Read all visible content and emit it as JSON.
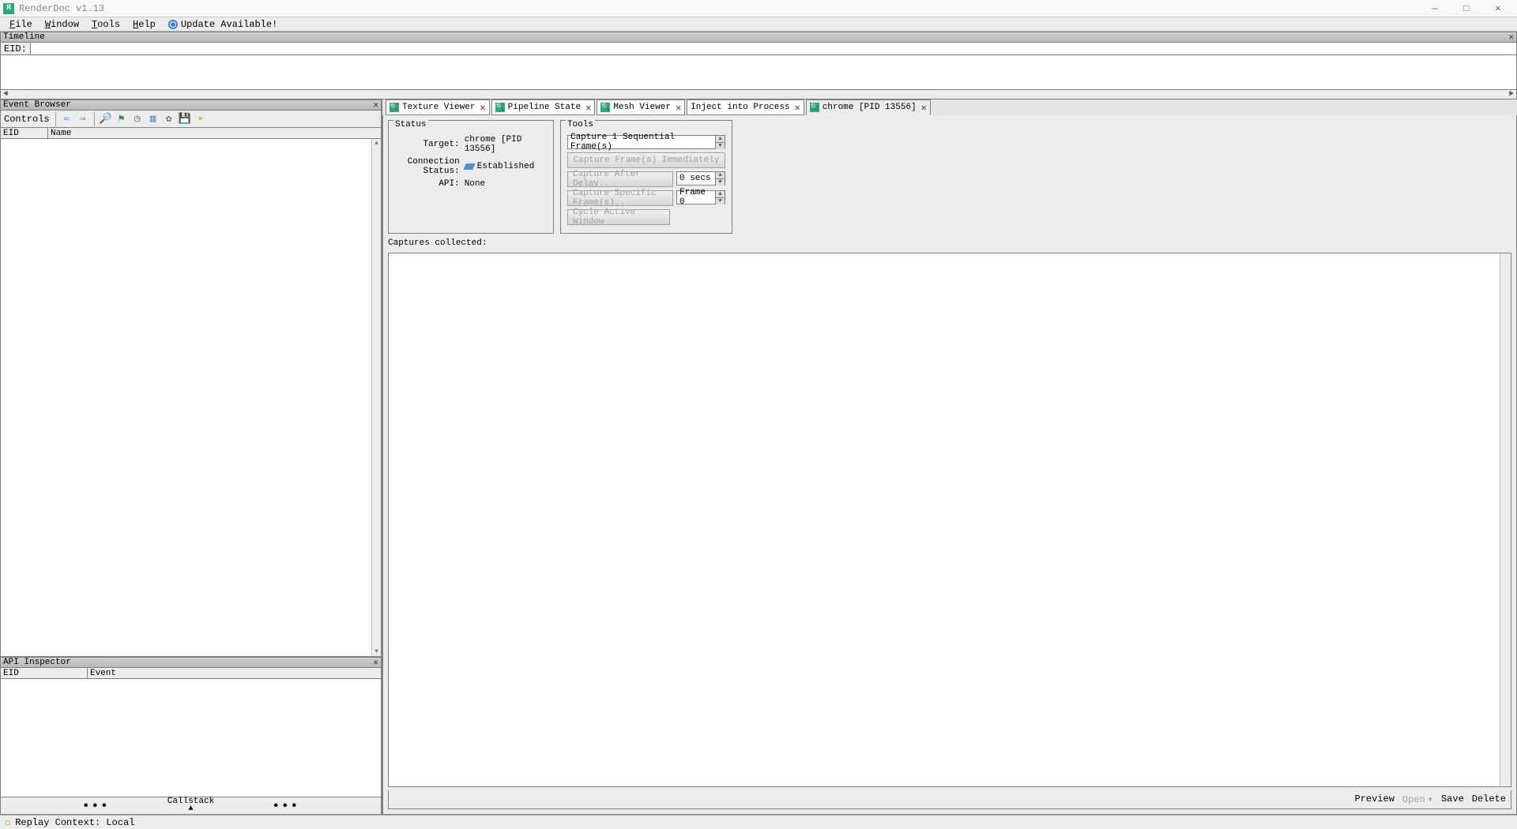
{
  "app": {
    "title": "RenderDoc v1.13"
  },
  "window_controls": {
    "min": "—",
    "max": "□",
    "close": "✕"
  },
  "menu": {
    "file": "File",
    "window": "Window",
    "tools": "Tools",
    "help": "Help",
    "update": "Update Available!"
  },
  "timeline": {
    "title": "Timeline",
    "eid_label": "EID:",
    "eid_value": ""
  },
  "event_browser": {
    "title": "Event Browser",
    "controls_label": "Controls",
    "col_eid": "EID",
    "col_name": "Name"
  },
  "api_inspector": {
    "title": "API Inspector",
    "col_eid": "EID",
    "col_event": "Event",
    "callstack": "Callstack"
  },
  "tabs": {
    "t0": "Texture Viewer",
    "t1": "Pipeline State",
    "t2": "Mesh Viewer",
    "t3": "Inject into Process",
    "t4": "chrome [PID 13556]"
  },
  "status": {
    "legend": "Status",
    "target_k": "Target:",
    "target_v": "chrome [PID 13556]",
    "conn_k": "Connection Status:",
    "conn_v": "Established",
    "api_k": "API:",
    "api_v": "None"
  },
  "tools": {
    "legend": "Tools",
    "capture_seq": "Capture 1 Sequential Frame(s)",
    "capture_now": "Capture Frame(s) Immediately",
    "capture_delay": "Capture After Delay..",
    "delay_value": "0 secs",
    "capture_specific": "Capture Specific Frame(s)..",
    "specific_value": "Frame 0",
    "cycle": "Cycle Active Window"
  },
  "captures": {
    "label": "Captures collected:",
    "preview": "Preview",
    "open": "Open",
    "save": "Save",
    "delete": "Delete"
  },
  "statusbar": {
    "text": "Replay Context: Local"
  }
}
